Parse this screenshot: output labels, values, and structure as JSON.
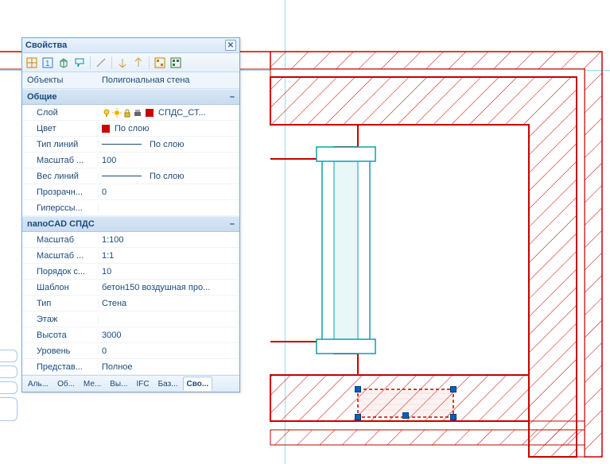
{
  "panel": {
    "title": "Свойства",
    "close_tooltip": "Закрыть"
  },
  "toolbar_icons": [
    "grid-toggle-icon",
    "numeric-mode-icon",
    "cube-icon",
    "highlight-icon",
    "diagonal-icon",
    "arrow-down-icon",
    "arrow-up-icon",
    "pattern-a-icon",
    "pattern-b-icon"
  ],
  "object": {
    "label": "Объекты",
    "value": "Полигональная стена"
  },
  "categories": [
    {
      "name": "Общие",
      "expanded": true,
      "rows": [
        {
          "label": "Слой",
          "value": "СПДС_СТ...",
          "type": "layer"
        },
        {
          "label": "Цвет",
          "value": "По слою",
          "type": "color",
          "color": "#c80000"
        },
        {
          "label": "Тип линий",
          "value": "По слою",
          "type": "linetype"
        },
        {
          "label": "Масштаб ...",
          "value": "100",
          "type": "text"
        },
        {
          "label": "Вес линий",
          "value": "По слою",
          "type": "lineweight"
        },
        {
          "label": "Прозрачн...",
          "value": "0",
          "type": "text"
        },
        {
          "label": "Гиперссы...",
          "value": "",
          "type": "text"
        }
      ]
    },
    {
      "name": "nanoCAD СПДС",
      "expanded": true,
      "rows": [
        {
          "label": "Масштаб",
          "value": "1:100",
          "type": "text"
        },
        {
          "label": "Масштаб ...",
          "value": "1:1",
          "type": "text"
        },
        {
          "label": "Порядок с...",
          "value": "10",
          "type": "text"
        },
        {
          "label": "Шаблон",
          "value": "бетон150 воздушная про...",
          "type": "text"
        },
        {
          "label": "Тип",
          "value": "Стена",
          "type": "text"
        },
        {
          "label": "Этаж",
          "value": "",
          "type": "text"
        },
        {
          "label": "Высота",
          "value": "3000",
          "type": "text"
        },
        {
          "label": "Уровень",
          "value": "0",
          "type": "text"
        },
        {
          "label": "Представ...",
          "value": "Полное",
          "type": "text"
        }
      ]
    }
  ],
  "tabs": [
    {
      "label": "Аль...",
      "active": false
    },
    {
      "label": "Об...",
      "active": false
    },
    {
      "label": "Ме...",
      "active": false
    },
    {
      "label": "Вы...",
      "active": false
    },
    {
      "label": "IFC",
      "active": false
    },
    {
      "label": "Баз...",
      "active": false
    },
    {
      "label": "Сво...",
      "active": true
    }
  ]
}
